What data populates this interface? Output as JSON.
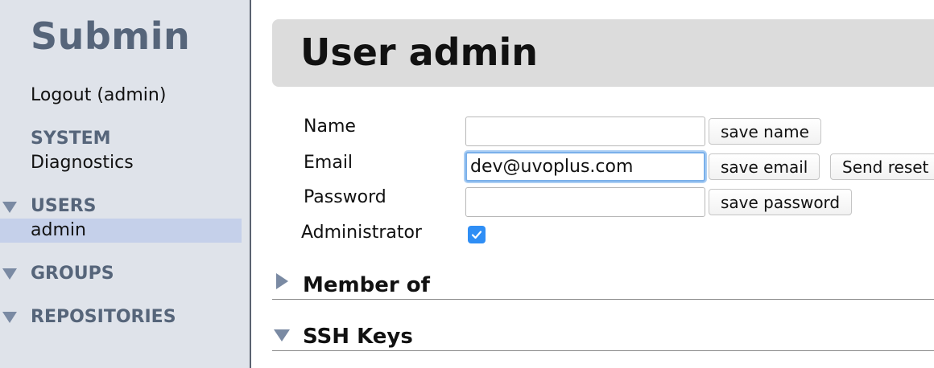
{
  "sidebar": {
    "brand": "Submin",
    "logout": "Logout (admin)",
    "system": {
      "label": "SYSTEM",
      "items": [
        "Diagnostics"
      ]
    },
    "users": {
      "label": "USERS",
      "items": [
        "admin"
      ],
      "selected": "admin"
    },
    "groups": {
      "label": "GROUPS"
    },
    "repositories": {
      "label": "REPOSITORIES"
    }
  },
  "main": {
    "title": "User admin",
    "form": {
      "name": {
        "label": "Name",
        "value": "",
        "button": "save name"
      },
      "email": {
        "label": "Email",
        "value": "dev@uvoplus.com",
        "button": "save email",
        "reset_button": "Send reset"
      },
      "password": {
        "label": "Password",
        "value": "",
        "button": "save password"
      },
      "administrator": {
        "label": "Administrator",
        "checked": true
      }
    },
    "sections": {
      "member_of": {
        "title": "Member of",
        "expanded": false
      },
      "ssh_keys": {
        "title": "SSH Keys",
        "expanded": true
      }
    }
  },
  "colors": {
    "sidebar_bg": "#dfe3ea",
    "sidebar_heading": "#56657a",
    "selected_row": "#c5d0ea",
    "header_bg": "#dcdcdc",
    "checkbox_accent": "#2f8ef5",
    "focus_ring": "#7ab0ea"
  }
}
